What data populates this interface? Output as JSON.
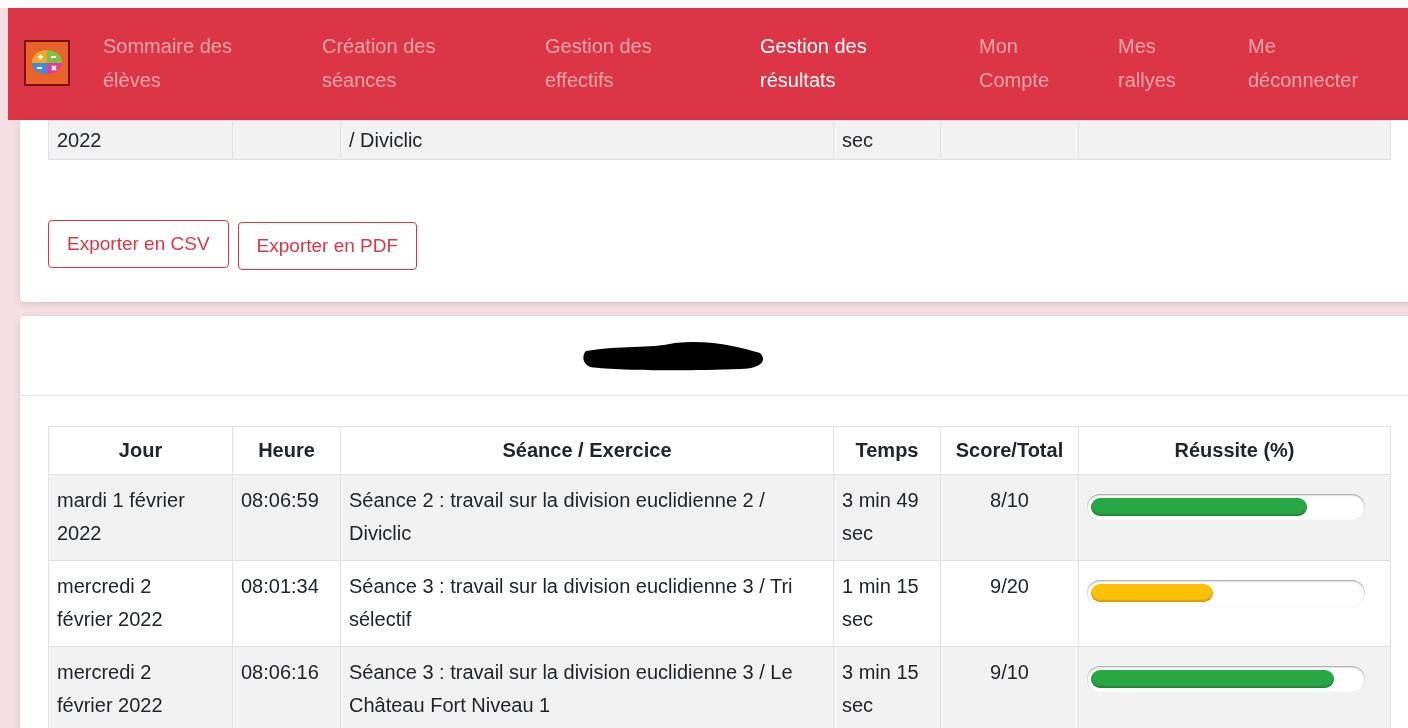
{
  "navbar": {
    "items": [
      {
        "label": "Sommaire des élèves",
        "selected": false
      },
      {
        "label": "Création des séances",
        "selected": false
      },
      {
        "label": "Gestion des effectifs",
        "selected": false
      },
      {
        "label": "Gestion des résultats",
        "selected": true
      },
      {
        "label": "Mon Compte",
        "selected": false
      },
      {
        "label": "Mes rallyes",
        "selected": false
      },
      {
        "label": "Me déconnecter",
        "selected": false
      }
    ]
  },
  "previous_results": {
    "rows": [
      {
        "jour": "2022",
        "seance": "/ Diviclic",
        "temps": "sec"
      }
    ]
  },
  "export_buttons": [
    "Exporter en CSV",
    "Exporter en PDF"
  ],
  "results": {
    "columns": [
      "Jour",
      "Heure",
      "Séance / Exercice",
      "Temps",
      "Score/Total",
      "Réussite (%)"
    ],
    "rows": [
      {
        "jour": "mardi 1 février 2022",
        "heure": "08:06:59",
        "seance": "Séance 2 : travail sur la division euclidienne 2 / Diviclic",
        "temps": "3 min 49 sec",
        "score": "8/10",
        "level": 0.8,
        "color": "#28a745"
      },
      {
        "jour": "mercredi 2 février 2022",
        "heure": "08:01:34",
        "seance": "Séance 3 : travail sur la division euclidienne 3 / Tri sélectif",
        "temps": "1 min 15 sec",
        "score": "9/20",
        "level": 0.45,
        "color": "#ffc107"
      },
      {
        "jour": "mercredi 2 février 2022",
        "heure": "08:06:16",
        "seance": "Séance 3 : travail sur la division euclidienne 3 / Le Château Fort Niveau 1",
        "temps": "3 min 15 sec",
        "score": "9/10",
        "level": 0.9,
        "color": "#28a745"
      }
    ]
  }
}
